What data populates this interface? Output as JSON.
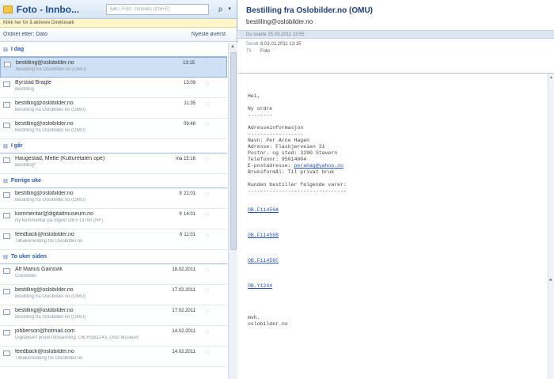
{
  "left": {
    "title": "Foto - Innbo...",
    "search_placeholder": "Søk i Foto - Innboks (Ctrl+E)",
    "search_btn": "ρ",
    "search_dd": "▾",
    "info": "Klikk her for å aktivere Direktesøk",
    "col_arrange": "Ordnet etter: Dato",
    "col_order": "Nyeste øverst",
    "groups": [
      {
        "label": "I dag",
        "items": [
          {
            "from": "bestilling@oslobilder.no",
            "subj": "Bestilling fra Oslobilder.no (OMU)",
            "time": "13:15",
            "sel": true
          },
          {
            "from": "Byrstad Bragle",
            "subj": "Bestilling",
            "time": "13:09"
          },
          {
            "from": "bestilling@oslobilder.no",
            "subj": "Bestilling fra Oslobilder.no (OMU)",
            "time": "11:35"
          },
          {
            "from": "bestilling@oslobilder.no",
            "subj": "Bestilling fra Oslobilder.no (OMU)",
            "time": "09:48"
          }
        ]
      },
      {
        "label": "I går",
        "items": [
          {
            "from": "Haugestad, Mette (Kulturetaten ope)",
            "subj": "Bestilling*",
            "time": "ma 15:16"
          }
        ]
      },
      {
        "label": "Forrige uke",
        "items": [
          {
            "from": "bestilling@oslobilder.no",
            "subj": "Bestilling fra Oslobilder.no (OMU)",
            "time": "fr 22:01"
          },
          {
            "from": "kommentar@digitaltmuseum.no",
            "subj": "Ny kommentar på objekt OB.F13700 (NF)",
            "time": "fr 14:01"
          },
          {
            "from": "feedback@oslobilder.no",
            "subj": "Tilbakemelding fra Oslobilder.no",
            "time": "fr 11:01"
          }
        ]
      },
      {
        "label": "To uker siden",
        "items": [
          {
            "from": "Alf Marius Gainsvik",
            "subj": "Oslobilder",
            "time": "18.02.2011"
          },
          {
            "from": "bestilling@oslobilder.no",
            "subj": "Bestilling fra Oslobilder.no (OMU)",
            "time": "17.02.2011"
          },
          {
            "from": "bestilling@oslobilder.no",
            "subj": "Bestilling fra Oslobilder.no (OMU)",
            "time": "17.02.2011"
          },
          {
            "from": "jobberson@hotmail.com",
            "subj": "Digitalisert privat fotosamling, OB.RSB1243, Oslo Museum",
            "time": "14.02.2011"
          },
          {
            "from": "feedback@oslobilder.no",
            "subj": "Tilbakemelding fra Oslobilder.no",
            "time": "14.02.2011"
          }
        ]
      }
    ]
  },
  "reading": {
    "subject": "Bestilling fra Oslobilder.no (OMU)",
    "from": "bestilling@oslobilder.no",
    "sent_bar": "Du svarte 25.03.2011 13:55",
    "meta": [
      {
        "k": "Sendt",
        "v": "8.03.01.2011 13:15"
      },
      {
        "k": "Til",
        "v": "Foto"
      }
    ],
    "body": [
      {
        "t": "Hei,"
      },
      {
        "t": ""
      },
      {
        "t": "Ny ordre"
      },
      {
        "t": "--------"
      },
      {
        "t": ""
      },
      {
        "t": "Adresseinformasjon"
      },
      {
        "t": "------------------"
      },
      {
        "t": "Navn: Per Arne Hagen"
      },
      {
        "t": "Adresse: Flaskjerveien 31"
      },
      {
        "t": "Postnr. og sted: 3290 Stavern"
      },
      {
        "t": "Telefonnr: 95014004"
      },
      {
        "t": "E-postadresse: ",
        "link": "perahag@yahoo.no"
      },
      {
        "t": "Bruksformål: Til privat bruk"
      },
      {
        "t": ""
      },
      {
        "t": "Kunden bestiller følgende varer:"
      },
      {
        "t": "--------------------------------"
      },
      {
        "t": ""
      },
      {
        "t": ""
      },
      {
        "t": "",
        "link": "OB.F11456A"
      },
      {
        "t": ""
      },
      {
        "t": ""
      },
      {
        "t": ""
      },
      {
        "t": "",
        "link": "OB.F11456B"
      },
      {
        "t": ""
      },
      {
        "t": ""
      },
      {
        "t": ""
      },
      {
        "t": "",
        "link": "OB.F11456C"
      },
      {
        "t": ""
      },
      {
        "t": ""
      },
      {
        "t": ""
      },
      {
        "t": "",
        "link": "OB.Y1244"
      },
      {
        "t": ""
      },
      {
        "t": ""
      },
      {
        "t": ""
      },
      {
        "t": ""
      },
      {
        "t": "mvh."
      },
      {
        "t": "oslobilder.no"
      }
    ]
  }
}
